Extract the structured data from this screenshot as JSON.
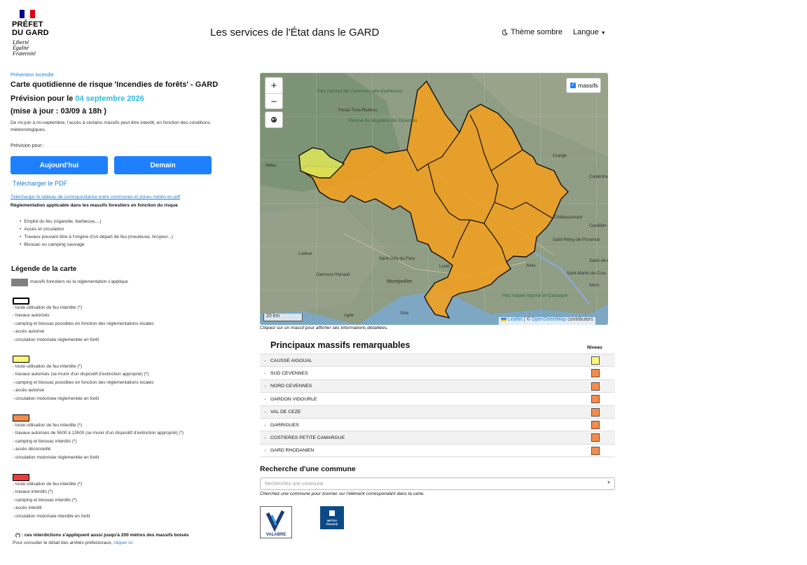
{
  "header": {
    "logo_line1": "PRÉFET",
    "logo_line2": "DU GARD",
    "motto": [
      "Liberté",
      "Égalité",
      "Fraternité"
    ],
    "site_title": "Les services de l'État dans le GARD",
    "theme_label": "Thème sombre",
    "language_label": "Langue"
  },
  "main": {
    "breadcrumb": "Prévention Incendie",
    "title": "Carte quotidienne de risque 'Incendies de forêts' - GARD",
    "forecast_prefix": "Prévision pour le ",
    "forecast_date": "04 septembre 2026",
    "update_text": "(mise à jour : 03/09 à 18h )",
    "intro": "De mi-juin à mi-septembre, l'accès à certains massifs peut être interdit, en fonction des conditions météorologiques.",
    "forecast_for_label": "Prévision pour :",
    "today_button": "Aujourd'hui",
    "tomorrow_button": "Demain",
    "pdf_link": "Télécharger le PDF",
    "correspondence_link": "Télécharger le tableau de correspondance entre communes et zones météo en pdf",
    "regulation_title": "Réglementation applicable dans les massifs forestiers en fonction du risque",
    "regulation_items": [
      "Emploi du feu (cigarette, barbecue,...)",
      "Accès et circulation",
      "Travaux pouvant être à l'origine d'un départ de feu (meuleuse, broyeur...)",
      "Bivouac ou camping sauvage"
    ]
  },
  "legend": {
    "title": "Légende de la carte",
    "gray_label": "massifs forestiers où la réglementation s'applique",
    "levels": [
      {
        "color": "#ffffff",
        "lines": [
          "- toute utilisation de feu interdite (*)",
          "- travaux autorisés",
          "- camping et bivouac possibles en fonction des réglementations locales",
          "- accès autorisé",
          "- circulation motorisée réglementée en forêt"
        ]
      },
      {
        "color": "#fbf77b",
        "lines": [
          "- toute utilisation de feu interdite (*)",
          "- travaux autorisés (se munir d'un dispositif d'extinction approprié) (*)",
          "- camping et bivouac possibles en fonction des réglementations locales",
          "- accès autorisé",
          "- circulation motorisée réglementée en forêt"
        ]
      },
      {
        "color": "#f58c4c",
        "lines": [
          "- toute utilisation de feu interdite (*)",
          "- travaux autorisés de 5h00 à 13h00 (se munir d'un dispositif d'extinction approprié) (*)",
          "- camping et bivouac interdits (*)",
          "- accès déconseillé",
          "- circulation motorisée réglementée en forêt"
        ]
      },
      {
        "color": "#ef3b3b",
        "lines": [
          "- toute utilisation de feu interdite (*)",
          "- travaux interdits (*)",
          "- camping et bivouac interdits (*)",
          "- accès interdit",
          "- circulation motorisée interdite en forêt"
        ]
      }
    ],
    "footnote": "(*) : ces interdictions s'appliquent aussi jusqu'à 200 mètres des massifs boisés",
    "consult_text": "Pour consulter le détail des arrêtés préfectoraux, ",
    "consult_link": "cliquer ici"
  },
  "map": {
    "zoom_in": "+",
    "zoom_out": "−",
    "layer_label": "massifs",
    "scale_label": "20 km",
    "attribution_leaflet": "Leaflet",
    "attribution_sep": " | © ",
    "attribution_osm": "OpenStreetMap",
    "attribution_suffix": " contributors",
    "caption": "Cliquez sur un massif pour afficher ses informations détaillées.",
    "place_labels": [
      "Millau",
      "Florac-Trois-Rivières",
      "Parc national des Cévennes (aire d'adhésion)",
      "Réserve de biosphère des Cévennes",
      "Lodève",
      "Saint-Gély-du-Fesc",
      "Montpellier",
      "Lunel",
      "Châteaurenard",
      "Saint-Rémy-de-Provence",
      "Arles",
      "Saint-Martin-de-Crau",
      "Parc naturel régional de Camargue",
      "Clermont-l'Hérault",
      "Carpentras",
      "Cavaillon",
      "Istres",
      "Salon-de-Provence",
      "Orange",
      "Agde",
      "Sète"
    ],
    "fill_color": "#f0a020",
    "yellow_color": "#d9e35a"
  },
  "massifs": {
    "title": "Principaux massifs remarquables",
    "niveau_label": "Niveau",
    "rows": [
      {
        "name": "CAUSSE AIGOUAL",
        "color": "#fbf77b"
      },
      {
        "name": "SUD CEVENNES",
        "color": "#f58c4c"
      },
      {
        "name": "NORD CEVENNES",
        "color": "#f58c4c"
      },
      {
        "name": "GARDON VIDOURLE",
        "color": "#f58c4c"
      },
      {
        "name": "VAL DE CEZE",
        "color": "#f58c4c"
      },
      {
        "name": "GARRIGUES",
        "color": "#f58c4c"
      },
      {
        "name": "COSTIERES PETITE CAMARGUE",
        "color": "#f58c4c"
      },
      {
        "name": "GARD RHODANIEN",
        "color": "#f58c4c"
      }
    ]
  },
  "search": {
    "title": "Recherche d'une commune",
    "placeholder": "Recherchez une commune",
    "help": "Cherchez une commune pour zoomer sur l'élément correspondant dans la carte."
  },
  "partners": {
    "valabre_label": "VALABRE",
    "meteo_label1": "MÉTÉO",
    "meteo_label2": "FRANCE"
  }
}
